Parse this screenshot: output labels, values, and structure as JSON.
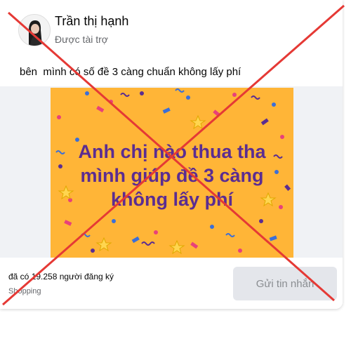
{
  "post": {
    "author_name": "Trần thị hạnh",
    "sponsored_label": "Được tài trợ",
    "text": "bên  mình có số đề 3 càng chuẩn không lấy phí"
  },
  "ad": {
    "headline_lines": [
      "Anh chị nào thua tha",
      "mình giúp đề 3 càng",
      "không lấy phí"
    ],
    "headline_color": "#5b2d91",
    "background_color": "#ffb537"
  },
  "footer": {
    "subscribers": "đã có 19.258 người đăng ký",
    "category": "Shopping",
    "button_label": "Gửi tin nhắn"
  },
  "overlay": {
    "type": "red-x-cross",
    "color": "#e53935"
  }
}
